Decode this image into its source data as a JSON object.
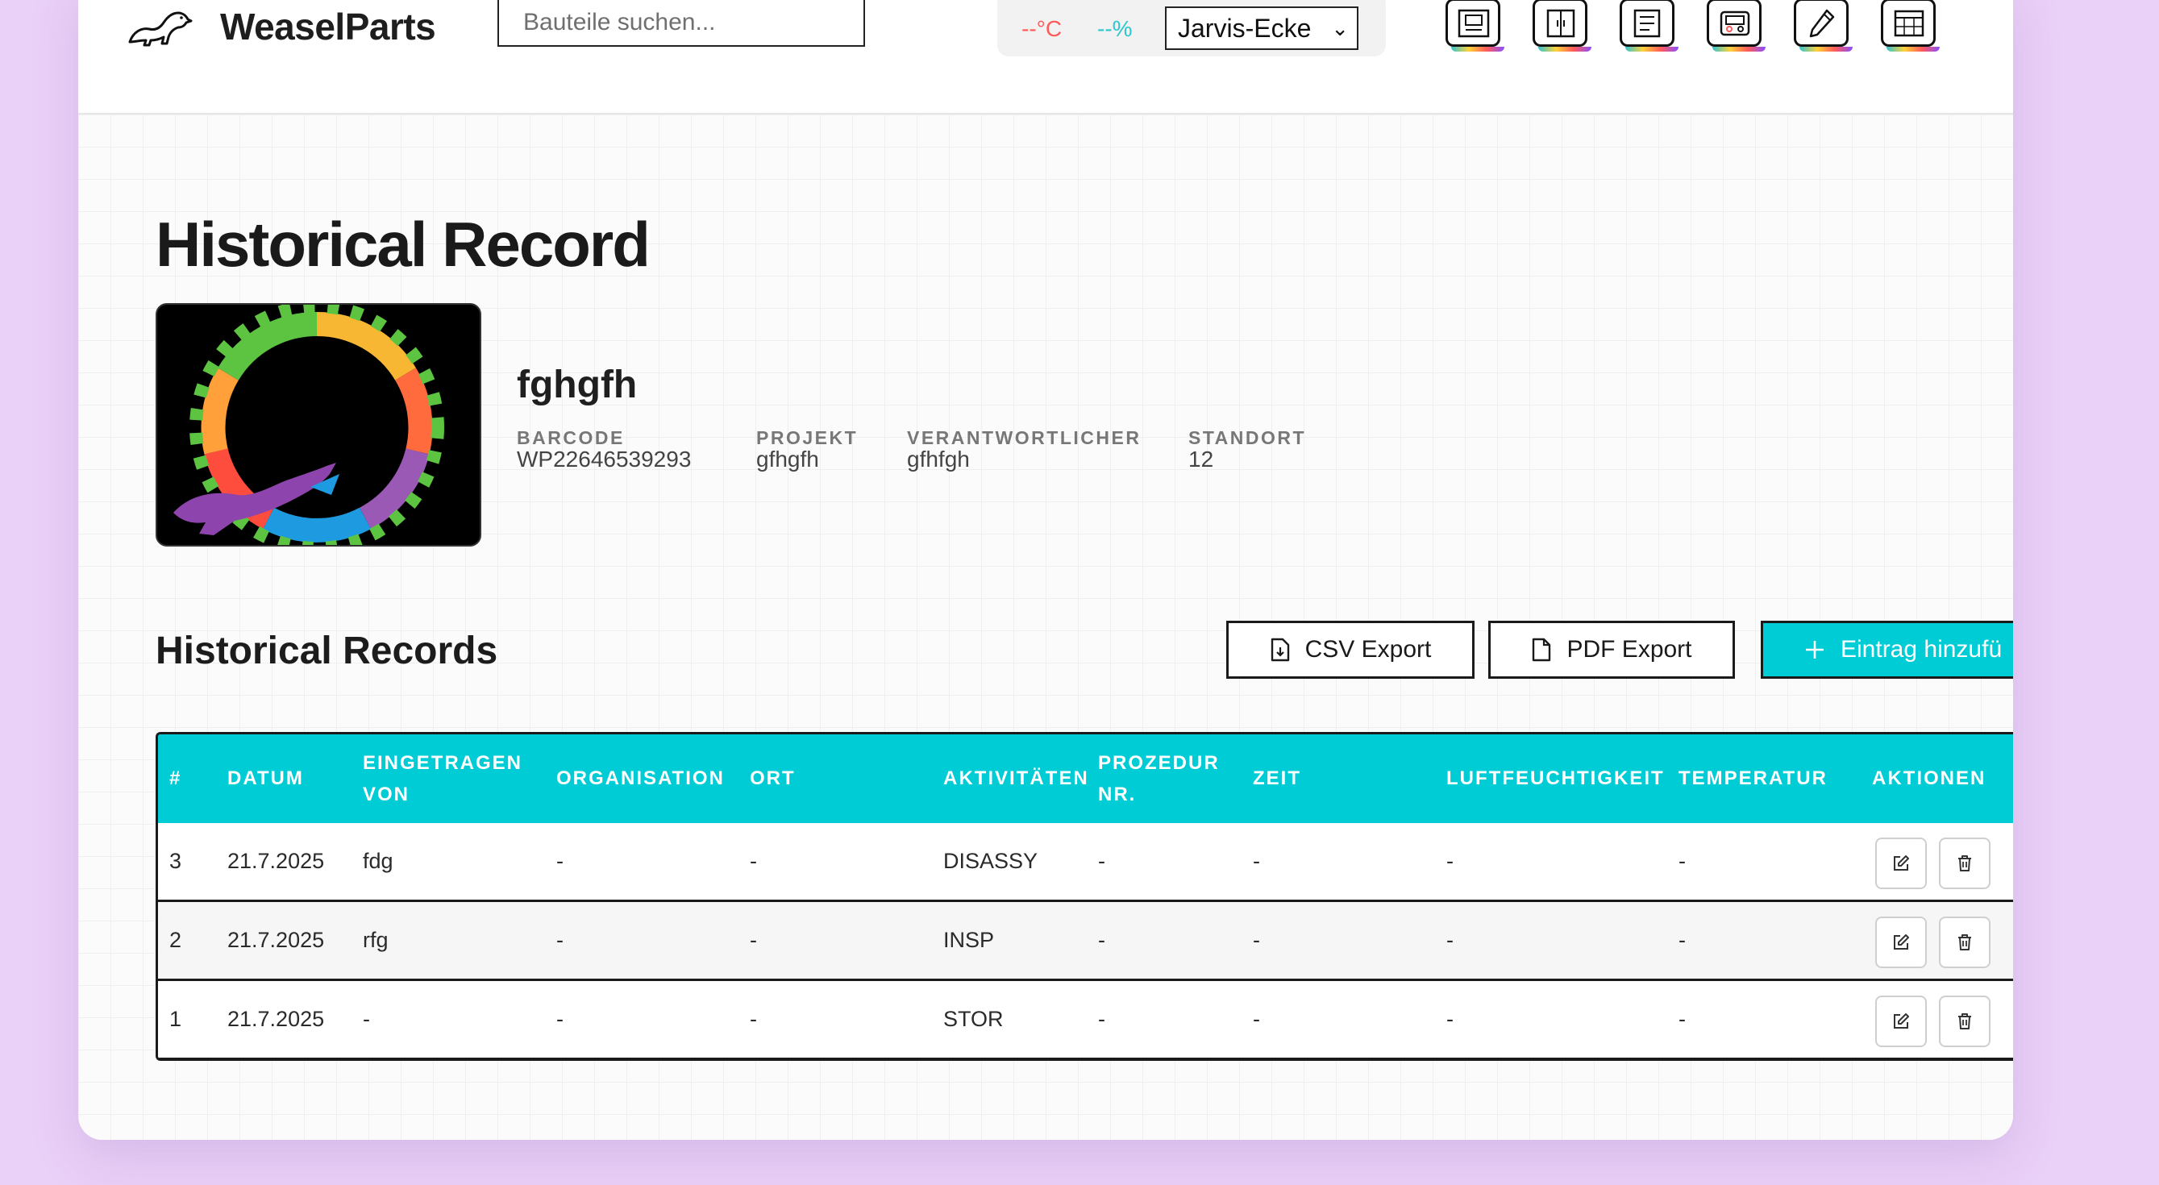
{
  "app": {
    "title": "WeaselParts"
  },
  "search": {
    "placeholder": "Bauteile suchen..."
  },
  "environment": {
    "temperature": "--°C",
    "humidity": "--%",
    "location": "Jarvis-Ecke"
  },
  "toolbar": {
    "icons": [
      "parts-catalog-icon",
      "cabinet-icon",
      "notes-icon",
      "device-icon",
      "marker-icon",
      "calendar-icon"
    ]
  },
  "page": {
    "title": "Historical Record"
  },
  "part": {
    "name": "fghgfh",
    "meta": [
      {
        "label": "BARCODE",
        "value": "WP22646539293"
      },
      {
        "label": "PROJEKT",
        "value": "gfhgfh"
      },
      {
        "label": "VERANTWORTLICHER",
        "value": "gfhfgh"
      },
      {
        "label": "STANDORT",
        "value": "12"
      }
    ]
  },
  "records": {
    "title": "Historical Records",
    "csv_label": "CSV Export",
    "pdf_label": "PDF Export",
    "add_label": "Eintrag hinzufü",
    "columns": [
      {
        "line1": "#",
        "line2": ""
      },
      {
        "line1": "DATUM",
        "line2": ""
      },
      {
        "line1": "EINGETRAGEN",
        "line2": "VON"
      },
      {
        "line1": "ORGANISATION",
        "line2": ""
      },
      {
        "line1": "ORT",
        "line2": ""
      },
      {
        "line1": "AKTIVITÄTEN",
        "line2": ""
      },
      {
        "line1": "PROZEDUR",
        "line2": "NR."
      },
      {
        "line1": "ZEIT",
        "line2": ""
      },
      {
        "line1": "LUFTFEUCHTIGKEIT",
        "line2": ""
      },
      {
        "line1": "TEMPERATUR",
        "line2": ""
      },
      {
        "line1": "AKTIONEN",
        "line2": ""
      }
    ],
    "rows": [
      [
        "3",
        "21.7.2025",
        "fdg",
        "-",
        "-",
        "DISASSY",
        "-",
        "-",
        "-",
        "-"
      ],
      [
        "2",
        "21.7.2025",
        "rfg",
        "-",
        "-",
        "INSP",
        "-",
        "-",
        "-",
        "-"
      ],
      [
        "1",
        "21.7.2025",
        "-",
        "-",
        "-",
        "STOR",
        "-",
        "-",
        "-",
        "-"
      ]
    ]
  },
  "colors": {
    "accent": "#00ccd6",
    "background": "#ead1f8",
    "temperature": "#ff5a5a",
    "humidity": "#2cc6cf"
  }
}
